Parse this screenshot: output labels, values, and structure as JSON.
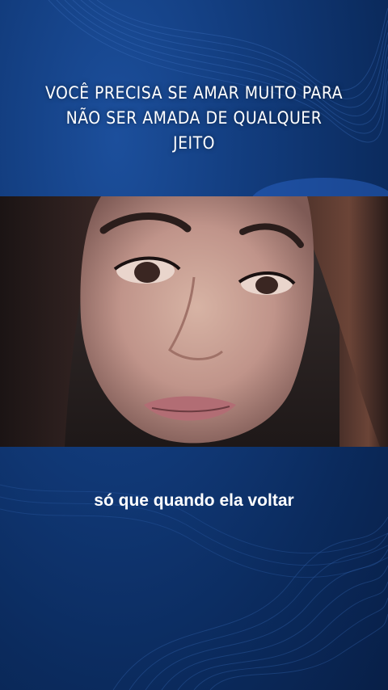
{
  "headline": {
    "lines": [
      "VOCÊ PRECISA SE AMAR MUITO PARA",
      "NÃO SER AMADA DE QUALQUER",
      "JEITO"
    ]
  },
  "video": {
    "subject": "woman-face-close-up"
  },
  "caption": {
    "text": "só que quando ela voltar"
  },
  "colors": {
    "background": "#123c7d",
    "background_dark": "#081f47",
    "text": "#ffffff"
  }
}
